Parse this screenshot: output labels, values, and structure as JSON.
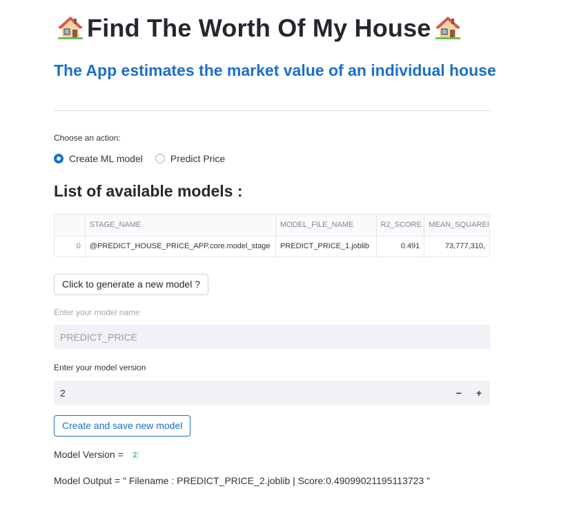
{
  "header": {
    "title": "Find The Worth Of My House",
    "subtitle": "The App estimates the market value of an individual house"
  },
  "action": {
    "label": "Choose an action:",
    "options": [
      {
        "label": "Create ML model",
        "selected": true
      },
      {
        "label": "Predict Price",
        "selected": false
      }
    ]
  },
  "models": {
    "heading": "List of available models :",
    "columns": [
      "",
      "STAGE_NAME",
      "MODEL_FILE_NAME",
      "R2_SCORE",
      "MEAN_SQUAREI"
    ],
    "rows": [
      [
        "0",
        "@PREDICT_HOUSE_PRICE_APP.core.model_stage",
        "PREDICT_PRICE_1.joblib",
        "0.491",
        "73,777,310,"
      ]
    ]
  },
  "generate_button": "Click to generate a new model ?",
  "model_name": {
    "label": "Enter your model name",
    "value": "PREDICT_PRICE"
  },
  "model_version": {
    "label": "Enter your model version",
    "value": "2",
    "minus": "−",
    "plus": "+"
  },
  "create_button": "Create and save new model",
  "output": {
    "version_label": "Model Version = ",
    "version_value": "2",
    "model_output": "Model Output = \" Filename : PREDICT_PRICE_2.joblib | Score:0.49099021195113723 \""
  },
  "colors": {
    "accent": "#1a6fc7",
    "text": "#31333f",
    "input_bg": "#f0f2f6",
    "badge_green": "#09ab3b"
  },
  "icons": [
    "house-icon",
    "house-icon"
  ]
}
